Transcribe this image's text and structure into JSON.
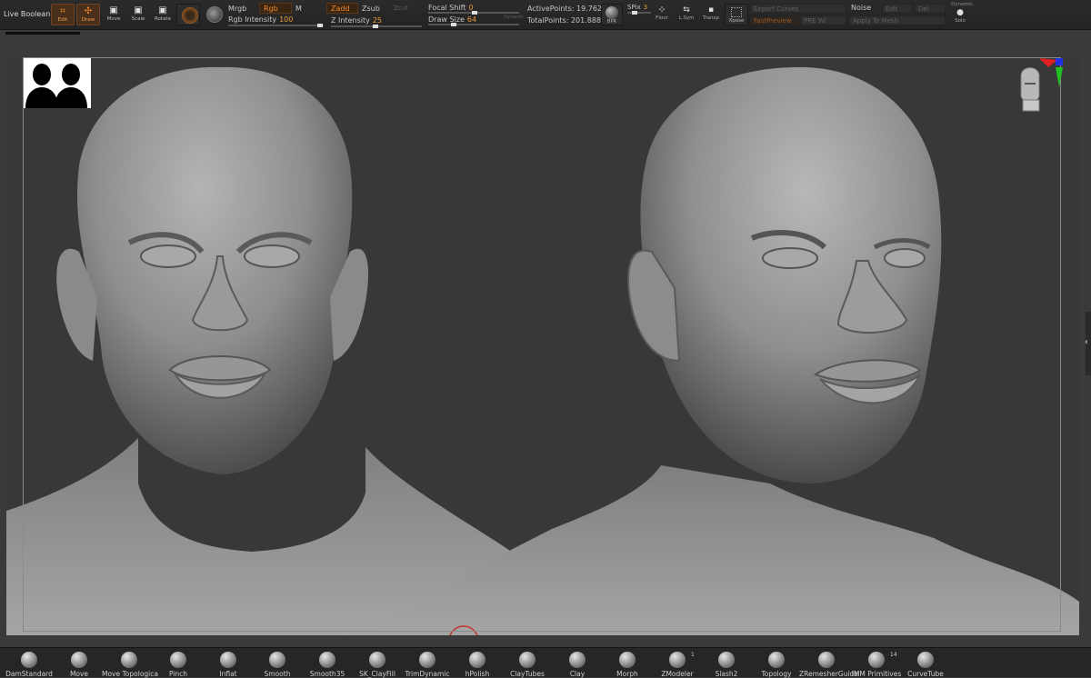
{
  "toolbar": {
    "live_boolean": "Live Boolean",
    "edit": "Edit",
    "draw": "Draw",
    "move": "Move",
    "scale": "Scale",
    "rotate": "Rotate",
    "mrgb": "Mrgb",
    "rgb": "Rgb",
    "m": "M",
    "rgb_intensity_label": "Rgb Intensity",
    "rgb_intensity_value": "100",
    "zadd": "Zadd",
    "zsub": "Zsub",
    "zcut": "Zcut",
    "z_intensity_label": "Z Intensity",
    "z_intensity_value": "25",
    "focal_shift_label": "Focal Shift",
    "focal_shift_value": "0",
    "draw_size_label": "Draw Size",
    "draw_size_value": "64",
    "dynamic": "Dynamic",
    "active_points": "ActivePoints: 19.762 Mil",
    "total_points": "TotalPoints: 201.888 Mil",
    "bpr": "BPR",
    "spix_label": "SPix",
    "spix_value": "3",
    "floor": "Floor",
    "l_sym": "L.Sym",
    "transp": "Transp",
    "xpose": "Xpose",
    "export_curves": "Export Curves",
    "fast_preview": "FastPreview",
    "pre_wi": "PRE Wi",
    "noise": "Noise",
    "edit_field": "Edit",
    "del": "Del",
    "apply_to_mesh": "Apply To Mesh",
    "solo": "Solo"
  },
  "colors": {
    "accent": "#f08a2c",
    "toolbar_bg": "#262626",
    "viewport_bg": "#383838"
  },
  "brushes": [
    {
      "label": "DamStandard"
    },
    {
      "label": "Move"
    },
    {
      "label": "Move Topologica"
    },
    {
      "label": "Pinch"
    },
    {
      "label": "Inflat"
    },
    {
      "label": "Smooth"
    },
    {
      "label": "Smooth35"
    },
    {
      "label": "SK_ClayFill"
    },
    {
      "label": "TrimDynamic"
    },
    {
      "label": "hPolish"
    },
    {
      "label": "ClayTubes"
    },
    {
      "label": "Clay"
    },
    {
      "label": "Morph"
    },
    {
      "label": "ZModeler",
      "count": "1"
    },
    {
      "label": "Slash2"
    },
    {
      "label": "Topology"
    },
    {
      "label": "ZRemesherGuide"
    },
    {
      "label": "IMM Primitives",
      "count": "14"
    },
    {
      "label": "CurveTube"
    }
  ]
}
